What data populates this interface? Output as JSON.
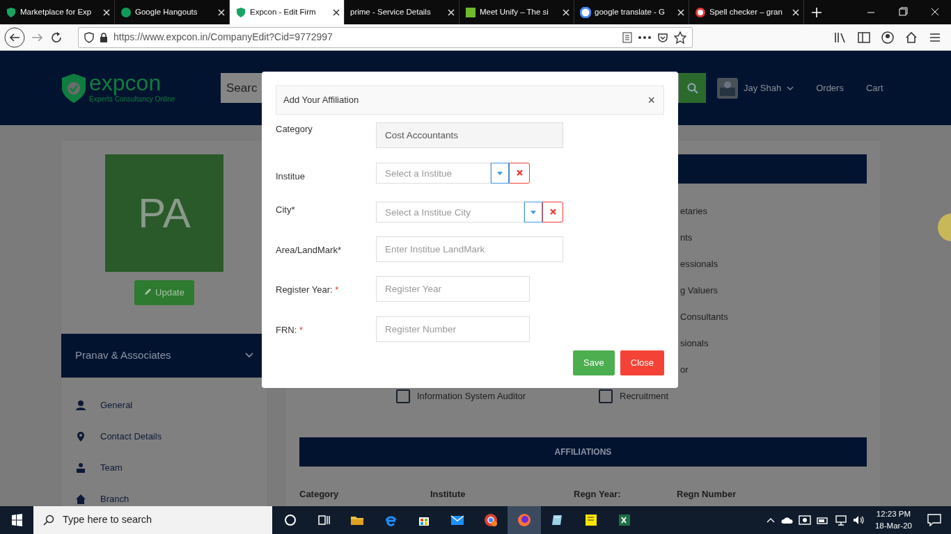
{
  "browser": {
    "tabs": [
      {
        "title": "Marketplace for Exp",
        "selected": false
      },
      {
        "title": "Google Hangouts",
        "selected": false
      },
      {
        "title": "Expcon - Edit Firm",
        "selected": true
      },
      {
        "title": "prime - Service Details",
        "selected": false
      },
      {
        "title": "Meet Unify – The si",
        "selected": false
      },
      {
        "title": "google translate - G",
        "selected": false
      },
      {
        "title": "Spell checker – gran",
        "selected": false
      }
    ],
    "url": "https://www.expcon.in/CompanyEdit?Cid=9772997"
  },
  "header": {
    "logo": "expcon",
    "tagline": "Experts Consultancy Online",
    "search_placeholder": "Searc",
    "user": "Jay Shah",
    "links": [
      "Orders",
      "Cart"
    ]
  },
  "profile": {
    "initials": "PA",
    "update_button": "Update",
    "firm_name": "Pranav & Associates",
    "menu": [
      "General",
      "Contact Details",
      "Team",
      "Branch"
    ]
  },
  "services": {
    "partial_options": [
      "etaries",
      "nts",
      "essionals",
      "g Valuers",
      "Consultants",
      "sionals",
      "or"
    ],
    "options": [
      {
        "label": "Information System Auditor",
        "checked": false
      },
      {
        "label": "Recruitment",
        "checked": false
      }
    ]
  },
  "affiliations": {
    "title": "AFFILIATIONS",
    "columns": [
      "Category",
      "Institute",
      "Regn Year:",
      "Regn Number"
    ]
  },
  "modal": {
    "title": "Add Your Affiliation",
    "close": "×",
    "fields": [
      {
        "label": "Category",
        "kind": "readonly",
        "value": "Cost Accountants"
      },
      {
        "label": "Institue",
        "kind": "select",
        "placeholder": "Select a Institue"
      },
      {
        "label": "City*",
        "kind": "select",
        "placeholder": "Select a Institue City"
      },
      {
        "label": "Area/LandMark*",
        "kind": "text",
        "placeholder": "Enter Institue LandMark"
      },
      {
        "label": "Register Year:",
        "required_mark": "*",
        "kind": "text",
        "placeholder": "Register Year"
      },
      {
        "label": "FRN:",
        "required_mark": "*",
        "kind": "text",
        "placeholder": "Register Number"
      }
    ],
    "buttons": [
      {
        "label": "Save",
        "kind": "save"
      },
      {
        "label": "Close",
        "kind": "close"
      }
    ]
  },
  "taskbar": {
    "search_placeholder": "Type here to search",
    "time": "12:23 PM",
    "date": "18-Mar-20"
  }
}
